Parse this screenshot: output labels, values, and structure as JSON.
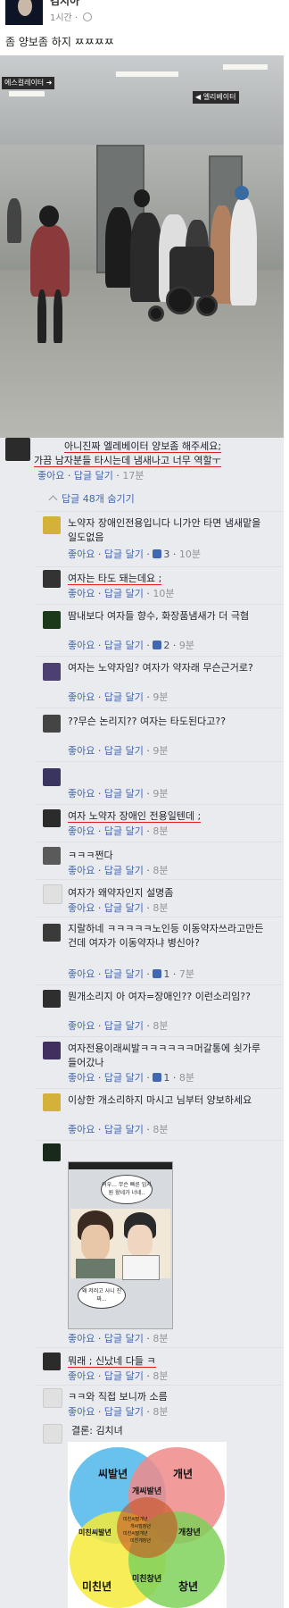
{
  "post": {
    "author": "김지아",
    "time": "1시간",
    "text": "좀 양보좀 하지 ㅉㅉㅉㅉ",
    "photo_signs": [
      "에스컬레이터 ➜",
      "◀ 엘리베이터"
    ]
  },
  "top_comment": {
    "text_line1": "아니진짜 엘레베이터 양보좀 해주세요;",
    "text_line2": "가끔 남자분들 타시는데 냄새나고 너무 역할ㅜ",
    "like": "좋아요",
    "reply": "답글 달기",
    "time": "17분"
  },
  "replies_toggle": "답글 48개 숨기기",
  "replies": [
    {
      "text": "노약자 장애인전용입니다 니가안 타면 냄새맡을일도없음",
      "like": "좋아요",
      "reply": "답글 달기",
      "likes": "3",
      "time": "10분"
    },
    {
      "text": "여자는 타도 돼는데요 ;",
      "like": "좋아요",
      "reply": "답글 달기",
      "time": "10분"
    },
    {
      "text": "땀내보다 여자들 향수, 화장품냄새가 더 극혐",
      "like": "좋아요",
      "reply": "답글 달기",
      "likes": "2",
      "time": "9분"
    },
    {
      "text": "여자는 노약자임? 여자가 약자래 무슨근거로?",
      "like": "좋아요",
      "reply": "답글 달기",
      "time": "9분"
    },
    {
      "text": "??무슨 논리지?? 여자는 타도된다고??",
      "like": "좋아요",
      "reply": "답글 달기",
      "time": "9분"
    },
    {
      "text": "",
      "like": "좋아요",
      "reply": "답글 달기",
      "time": "9분"
    },
    {
      "text": "여자 노약자 장애인 전용일텐데 ;",
      "like": "좋아요",
      "reply": "답글 달기",
      "time": "8분"
    },
    {
      "text": "ㅋㅋㅋ쩐다",
      "like": "좋아요",
      "reply": "답글 달기",
      "time": "8분"
    },
    {
      "text": "여자가 왜약자인지 설명좀",
      "like": "좋아요",
      "reply": "답글 달기",
      "time": "8분"
    },
    {
      "text": "지랄하네 ㅋㅋㅋㅋㅋ노인등 이동약자쓰라고만든건데 여자가 이동약자냐 병신아?",
      "like": "좋아요",
      "reply": "답글 달기",
      "likes": "1",
      "time": "7분"
    },
    {
      "text": "뭔개소리지 아 여자=장애인?? 이런소리임??",
      "like": "좋아요",
      "reply": "답글 달기",
      "time": "8분"
    },
    {
      "text": "여자전용이래씨발ㅋㅋㅋㅋㅋㅋ머갈통에 쇳가루들어갔나",
      "like": "좋아요",
      "reply": "답글 달기",
      "likes": "1",
      "time": "8분"
    },
    {
      "text": "이상한 개소리하지 마시고 님부터 양보하세요",
      "like": "좋아요",
      "reply": "답글 달기",
      "time": "8분"
    },
    {
      "text": "",
      "like": "좋아요",
      "reply": "답글 달기",
      "time": "8분"
    },
    {
      "text": "뭐래 ; 신났네 다들 ㅋ",
      "like": "좋아요",
      "reply": "답글 달기",
      "time": "8분"
    },
    {
      "text": "ㅋㅋ와 직접 보니까 소름",
      "like": "좋아요",
      "reply": "답글 달기",
      "time": "8분"
    },
    {
      "text": "결론: 김치녀"
    }
  ],
  "cartoon": {
    "bubble1": "어우... 무슨 빠른 임지원 왔네가 너네..",
    "bubble2": "왜 저러고 사니 진짜..."
  },
  "venn": {
    "a": "씨발년",
    "b": "개년",
    "c": "미친년",
    "d": "창년",
    "ab": "개씨발년",
    "ac": "미친씨발년",
    "bd": "개창년",
    "cd": "미친창년",
    "center_lines": [
      "미친씨발개년",
      "개씨발창년",
      "미친씨발개년",
      "미친개창년"
    ]
  }
}
